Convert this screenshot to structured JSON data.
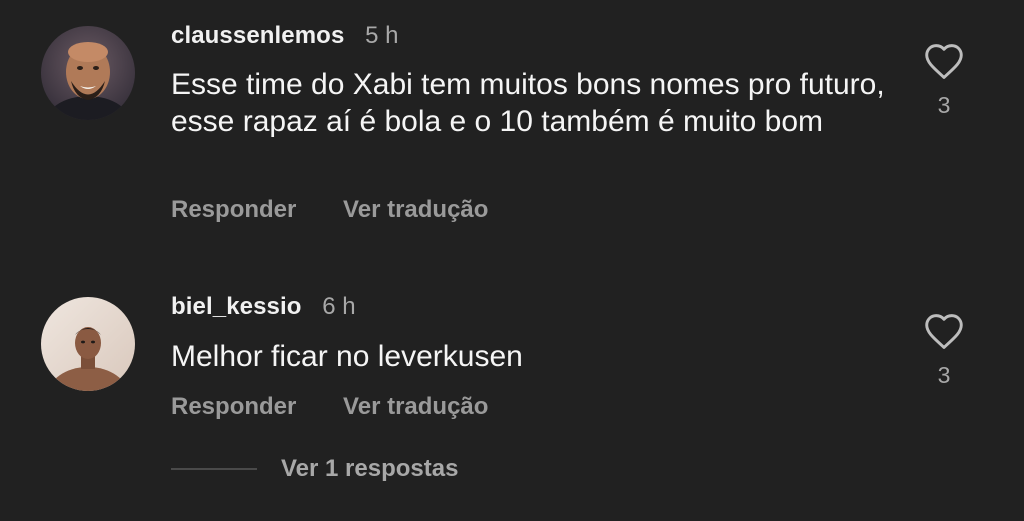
{
  "comments": [
    {
      "username": "claussenlemos",
      "time": "5 h",
      "text": "Esse time do Xabi tem muitos bons nomes pro futuro, esse rapaz aí é bola e o 10 também é muito bom",
      "reply_label": "Responder",
      "translate_label": "Ver tradução",
      "likes": "3"
    },
    {
      "username": "biel_kessio",
      "time": "6 h",
      "text": "Melhor ficar no leverkusen",
      "reply_label": "Responder",
      "translate_label": "Ver tradução",
      "likes": "3"
    }
  ],
  "replies_toggle": "Ver 1 respostas",
  "icons": {
    "like": "heart-outline-icon"
  },
  "colors": {
    "background": "#212121",
    "primary_text": "#f1f1f1",
    "secondary_text": "#a8a8a8"
  }
}
